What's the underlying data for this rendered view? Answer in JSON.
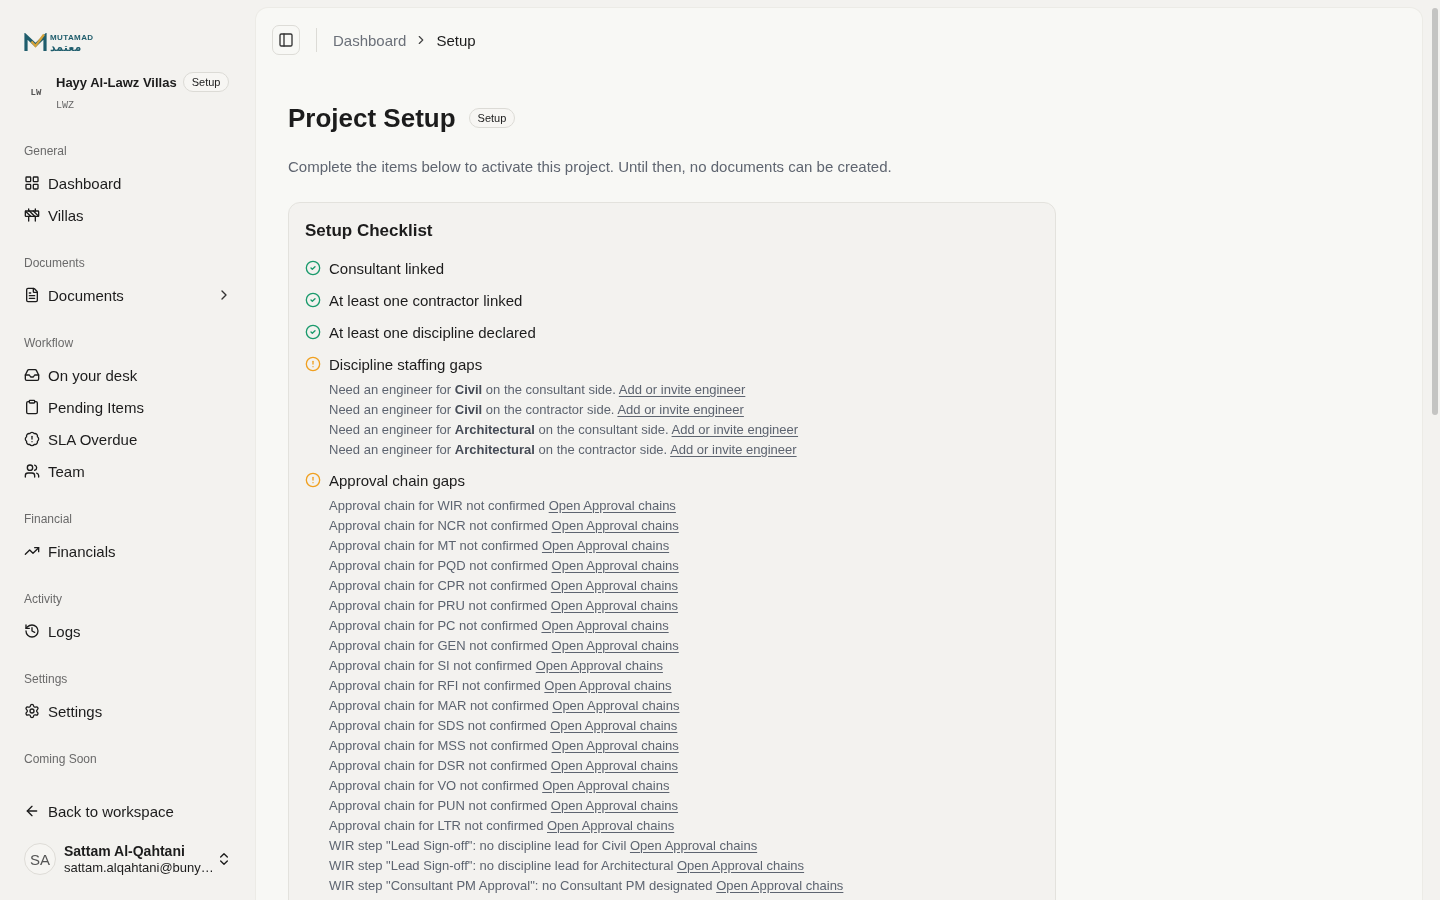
{
  "sidebar": {
    "logo": {
      "wordmark": "MUTAMAD",
      "wordmark_arabic": "معتمد"
    },
    "project": {
      "avatar": "LW",
      "name": "Hayy Al-Lawz Villas",
      "badge": "Setup",
      "code": "LWZ"
    },
    "groups": [
      {
        "label": "General",
        "items": [
          {
            "label": "Dashboard",
            "kind": "link"
          },
          {
            "label": "Villas",
            "kind": "link"
          }
        ]
      },
      {
        "label": "Documents",
        "items": [
          {
            "label": "Documents",
            "kind": "collapsible",
            "expanded": false
          }
        ]
      },
      {
        "label": "Workflow",
        "items": [
          {
            "label": "On your desk",
            "kind": "link"
          },
          {
            "label": "Pending Items",
            "kind": "link"
          },
          {
            "label": "SLA Overdue",
            "kind": "link"
          },
          {
            "label": "Team",
            "kind": "link"
          }
        ]
      },
      {
        "label": "Financial",
        "items": [
          {
            "label": "Financials",
            "kind": "link"
          }
        ]
      },
      {
        "label": "Activity",
        "items": [
          {
            "label": "Logs",
            "kind": "link"
          }
        ]
      },
      {
        "label": "Settings",
        "items": [
          {
            "label": "Settings",
            "kind": "link"
          }
        ]
      },
      {
        "label": "Coming Soon"
      }
    ],
    "back_link": "Back to workspace",
    "user": {
      "initials": "SA",
      "name": "Sattam Al-Qahtani",
      "email": "sattam.alqahtani@buny…"
    }
  },
  "header": {
    "breadcrumb": [
      {
        "label": "Dashboard",
        "current": false
      },
      {
        "label": "Setup",
        "current": true
      }
    ]
  },
  "page": {
    "title": "Project Setup",
    "badge": "Setup",
    "description": "Complete the items below to activate this project. Until then, no documents can be created."
  },
  "checklist": {
    "title": "Setup Checklist",
    "items": [
      {
        "label": "Consultant linked",
        "complete": true
      },
      {
        "label": "At least one contractor linked",
        "complete": true
      },
      {
        "label": "At least one discipline declared",
        "complete": true
      },
      {
        "label": "Discipline staffing gaps",
        "complete": false,
        "details": [
          {
            "text": "Need an engineer for **Civil** on the consultant side.",
            "link": "Add or invite engineer"
          },
          {
            "text": "Need an engineer for **Civil** on the contractor side.",
            "link": "Add or invite engineer"
          },
          {
            "text": "Need an engineer for **Architectural** on the consultant side.",
            "link": "Add or invite engineer"
          },
          {
            "text": "Need an engineer for **Architectural** on the contractor side.",
            "link": "Add or invite engineer"
          }
        ]
      },
      {
        "label": "Approval chain gaps",
        "complete": false,
        "details": [
          {
            "text": "Approval chain for WIR not confirmed",
            "link": "Open Approval chains"
          },
          {
            "text": "Approval chain for NCR not confirmed",
            "link": "Open Approval chains"
          },
          {
            "text": "Approval chain for MT not confirmed",
            "link": "Open Approval chains"
          },
          {
            "text": "Approval chain for PQD not confirmed",
            "link": "Open Approval chains"
          },
          {
            "text": "Approval chain for CPR not confirmed",
            "link": "Open Approval chains"
          },
          {
            "text": "Approval chain for PRU not confirmed",
            "link": "Open Approval chains"
          },
          {
            "text": "Approval chain for PC not confirmed",
            "link": "Open Approval chains"
          },
          {
            "text": "Approval chain for GEN not confirmed",
            "link": "Open Approval chains"
          },
          {
            "text": "Approval chain for SI not confirmed",
            "link": "Open Approval chains"
          },
          {
            "text": "Approval chain for RFI not confirmed",
            "link": "Open Approval chains"
          },
          {
            "text": "Approval chain for MAR not confirmed",
            "link": "Open Approval chains"
          },
          {
            "text": "Approval chain for SDS not confirmed",
            "link": "Open Approval chains"
          },
          {
            "text": "Approval chain for MSS not confirmed",
            "link": "Open Approval chains"
          },
          {
            "text": "Approval chain for DSR not confirmed",
            "link": "Open Approval chains"
          },
          {
            "text": "Approval chain for VO not confirmed",
            "link": "Open Approval chains"
          },
          {
            "text": "Approval chain for PUN not confirmed",
            "link": "Open Approval chains"
          },
          {
            "text": "Approval chain for LTR not confirmed",
            "link": "Open Approval chains"
          },
          {
            "text": "WIR step \"Lead Sign-off\": no discipline lead for Civil",
            "link": "Open Approval chains"
          },
          {
            "text": "WIR step \"Lead Sign-off\": no discipline lead for Architectural",
            "link": "Open Approval chains"
          },
          {
            "text": "WIR step \"Consultant PM Approval\": no Consultant PM designated",
            "link": "Open Approval chains"
          }
        ]
      }
    ]
  }
}
